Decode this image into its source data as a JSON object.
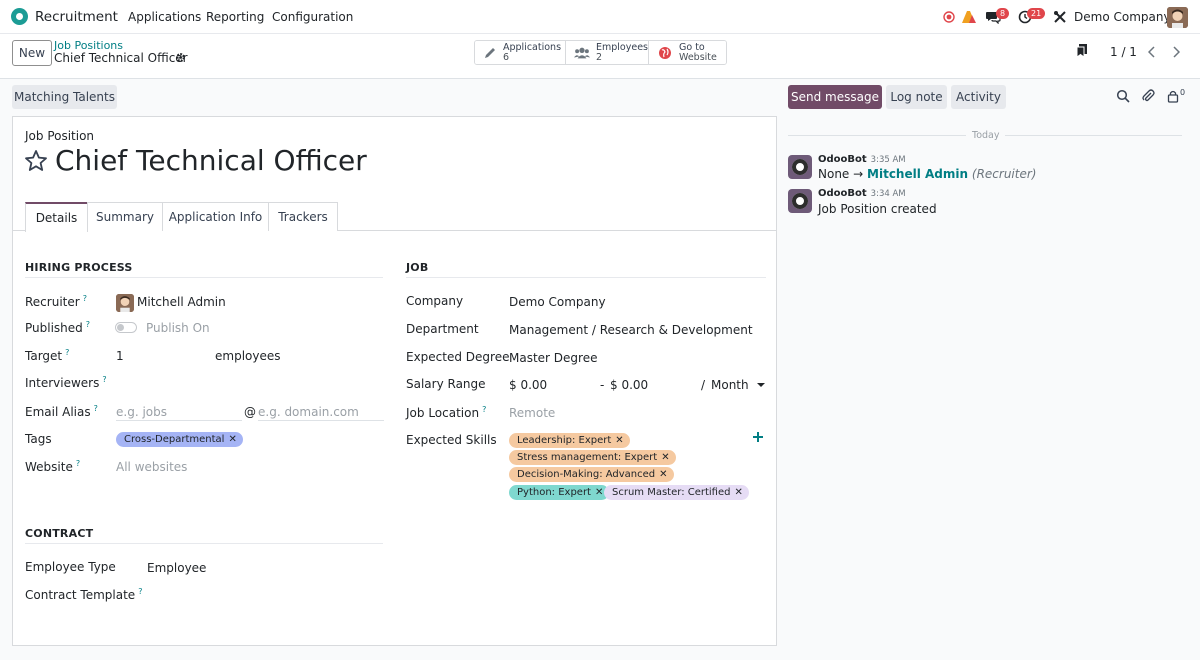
{
  "navbar": {
    "app_name": "Recruitment",
    "menu": [
      "Applications",
      "Reporting",
      "Configuration"
    ],
    "badges": {
      "messages": "8",
      "activities": "21"
    },
    "company": "Demo Company"
  },
  "control_panel": {
    "new_label": "New",
    "breadcrumb_parent": "Job Positions",
    "breadcrumb_current": "Chief Technical Officer",
    "smart_buttons": [
      {
        "label": "Applications",
        "value": "6",
        "icon": "pencil-icon"
      },
      {
        "label": "Employees",
        "value": "2",
        "icon": "users-icon"
      },
      {
        "label": "Go to",
        "value": "Website",
        "icon": "globe-icon"
      }
    ],
    "pager": "1 / 1"
  },
  "form": {
    "matching_label": "Matching Talents",
    "job_position_label": "Job Position",
    "title": "Chief Technical Officer",
    "tabs": [
      "Details",
      "Summary",
      "Application Info",
      "Trackers"
    ],
    "hiring": {
      "section": "HIRING PROCESS",
      "recruiter_label": "Recruiter",
      "recruiter_value": "Mitchell Admin",
      "published_label": "Published",
      "published_value": "Publish On",
      "target_label": "Target",
      "target_value": "1",
      "target_unit": "employees",
      "interviewers_label": "Interviewers",
      "email_alias_label": "Email Alias",
      "email_alias_placeholder": "e.g. jobs",
      "email_at": "@",
      "email_domain_placeholder": "e.g. domain.com",
      "tags_label": "Tags",
      "tag_value": "Cross-Departmental",
      "website_label": "Website",
      "website_placeholder": "All websites"
    },
    "job": {
      "section": "JOB",
      "company_label": "Company",
      "company_value": "Demo Company",
      "department_label": "Department",
      "department_value": "Management / Research & Development",
      "degree_label": "Expected Degree",
      "degree_value": "Master Degree",
      "salary_label": "Salary Range",
      "salary_min": "$ 0.00",
      "salary_sep": "-",
      "salary_max": "$ 0.00",
      "salary_slash": "/",
      "salary_period": "Month",
      "location_label": "Job Location",
      "location_placeholder": "Remote",
      "skills_label": "Expected Skills",
      "skills": [
        {
          "label": "Leadership: Expert",
          "color": "#f5c9a0"
        },
        {
          "label": "Stress management: Expert",
          "color": "#f5c9a0"
        },
        {
          "label": "Decision-Making: Advanced",
          "color": "#f5c9a0"
        },
        {
          "label": "Python: Expert",
          "color": "#7fd8cf"
        },
        {
          "label": "Scrum Master: Certified",
          "color": "#e6dcf5"
        }
      ]
    },
    "contract": {
      "section": "CONTRACT",
      "employee_type_label": "Employee Type",
      "employee_type_value": "Employee",
      "template_label": "Contract Template"
    }
  },
  "chatter": {
    "send_message": "Send message",
    "log_note": "Log note",
    "activity": "Activity",
    "followers_count": "0",
    "today": "Today",
    "messages": [
      {
        "author": "OdooBot",
        "time": "3:35 AM",
        "from": "None",
        "arrow": "→",
        "to": "Mitchell Admin",
        "role": "(Recruiter)"
      },
      {
        "author": "OdooBot",
        "time": "3:34 AM",
        "body": "Job Position created"
      }
    ]
  },
  "colors": {
    "brand": "#714b67",
    "link": "#017e84",
    "tag_cross_departmental": "#a5b4f5"
  }
}
